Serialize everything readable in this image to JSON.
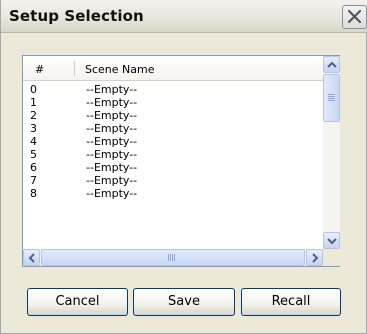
{
  "window": {
    "title": "Setup Selection"
  },
  "list": {
    "columns": {
      "number": "#",
      "name": "Scene Name"
    },
    "rows": [
      {
        "num": "0",
        "name": "--Empty--"
      },
      {
        "num": "1",
        "name": "--Empty--"
      },
      {
        "num": "2",
        "name": "--Empty--"
      },
      {
        "num": "3",
        "name": "--Empty--"
      },
      {
        "num": "4",
        "name": "--Empty--"
      },
      {
        "num": "5",
        "name": "--Empty--"
      },
      {
        "num": "6",
        "name": "--Empty--"
      },
      {
        "num": "7",
        "name": "--Empty--"
      },
      {
        "num": "8",
        "name": "--Empty--"
      }
    ]
  },
  "buttons": {
    "cancel": "Cancel",
    "save": "Save",
    "recall": "Recall"
  },
  "icons": {
    "close": "close-icon",
    "scroll_up": "chevron-up-icon",
    "scroll_down": "chevron-down-icon",
    "scroll_left": "chevron-left-icon",
    "scroll_right": "chevron-right-icon"
  },
  "colors": {
    "dialog_bg": "#ece9d8",
    "list_border": "#7f9db9",
    "button_border": "#003c74"
  }
}
